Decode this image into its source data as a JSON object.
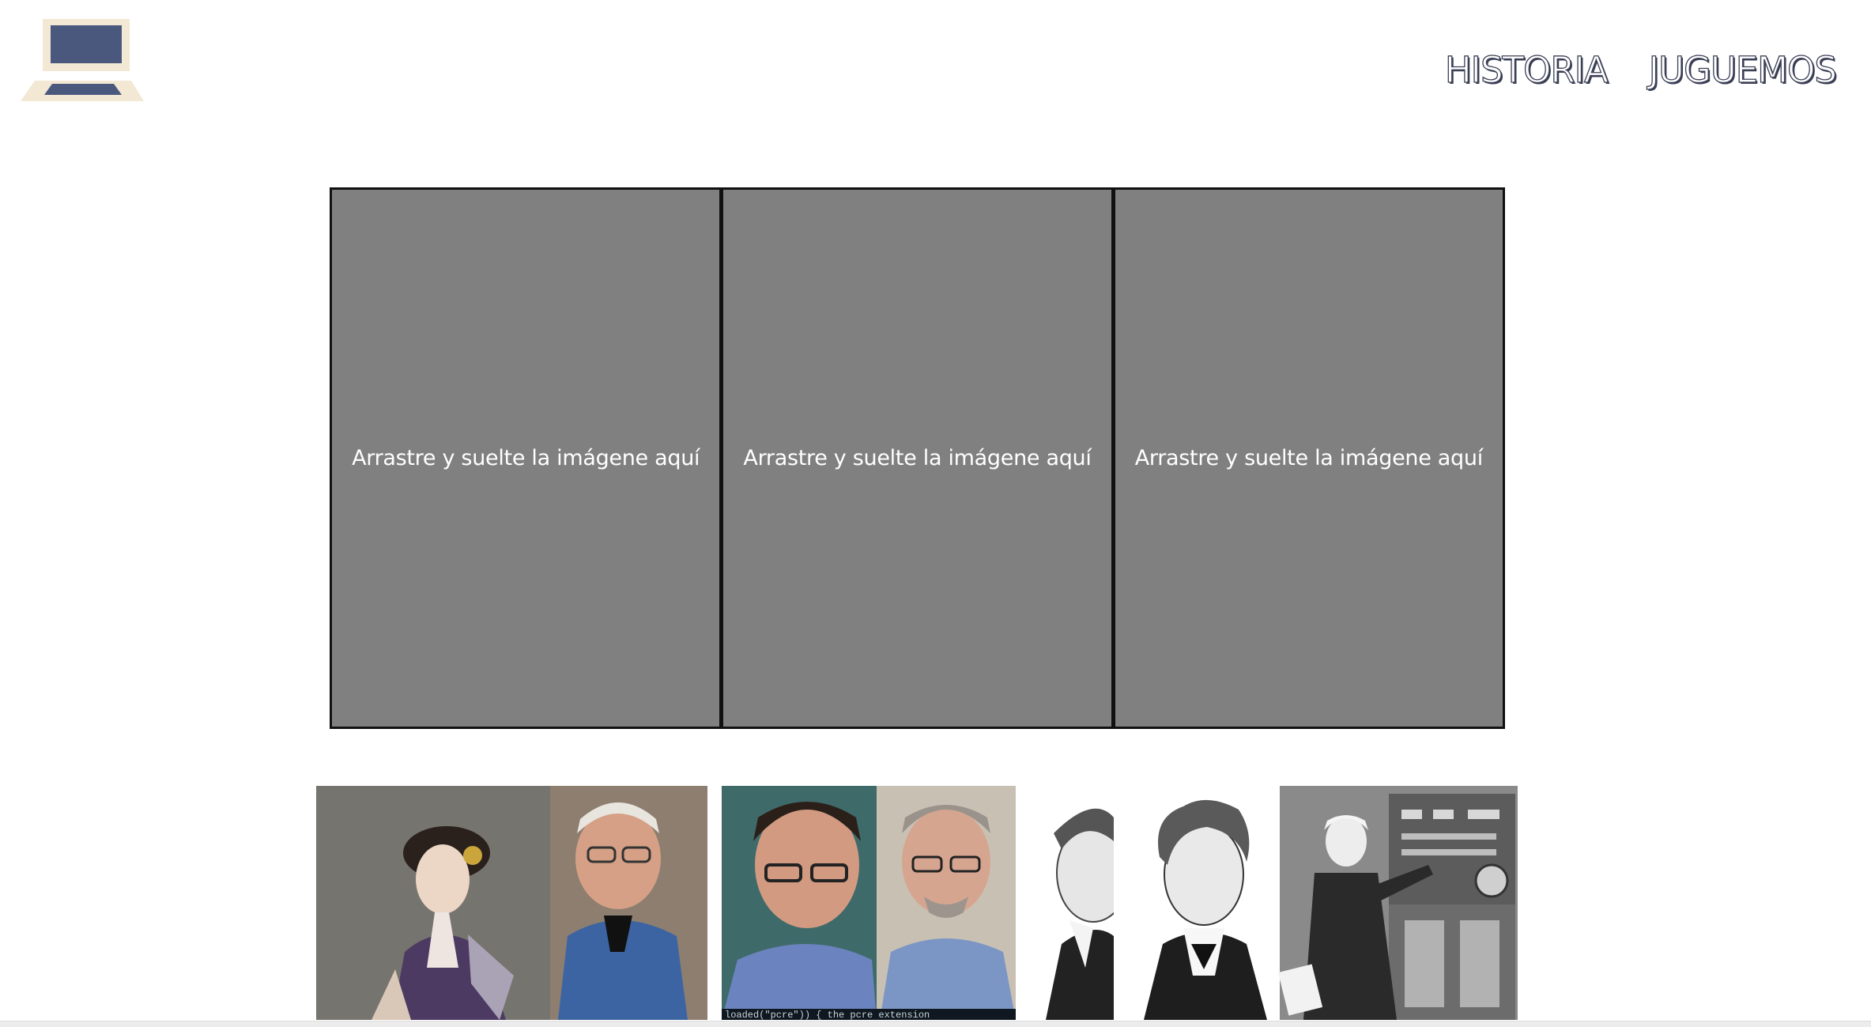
{
  "header": {
    "logo_icon": "laptop-icon",
    "logo_colors": {
      "frame": "#f2e8d4",
      "screen": "#4a587e"
    },
    "nav": [
      {
        "label": "HISTORIA"
      },
      {
        "label": "JUGUEMOS"
      }
    ]
  },
  "drop_zones": [
    {
      "label": "Arrastre y suelte la imágene aquí"
    },
    {
      "label": "Arrastre y suelte la imágene aquí"
    },
    {
      "label": "Arrastre y suelte la imágene aquí"
    }
  ],
  "cards": [
    {
      "icon": "portrait-pair-photo-1"
    },
    {
      "icon": "portrait-pair-photo-2"
    },
    {
      "icon": "portrait-pair-photo-3"
    }
  ],
  "card_caption_fragment": "loaded(\"pcre\")) {  the pcre extension"
}
